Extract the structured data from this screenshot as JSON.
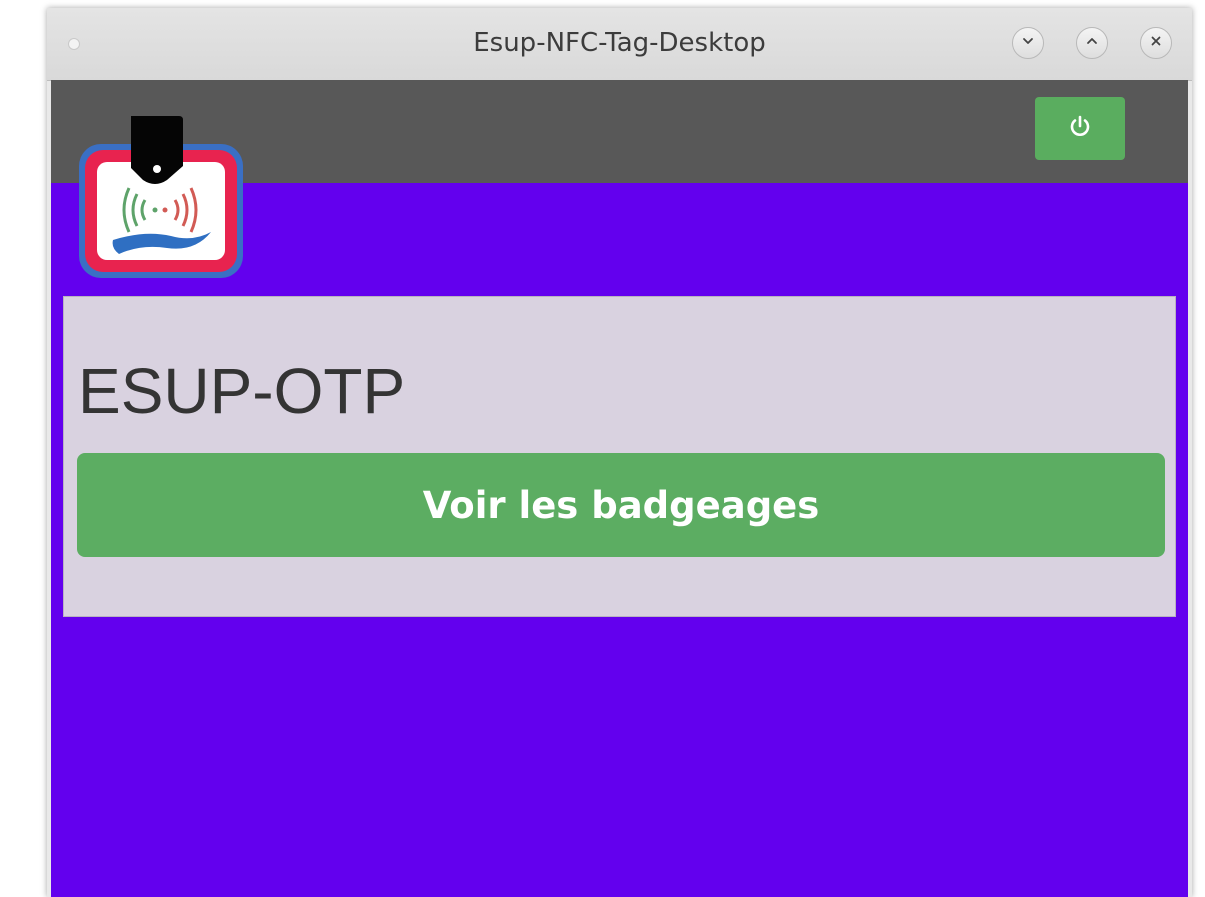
{
  "window": {
    "title": "Esup-NFC-Tag-Desktop",
    "controls": {
      "minimize_icon": "chevron-down-icon",
      "maximize_icon": "chevron-up-icon",
      "close_icon": "close-icon"
    }
  },
  "header": {
    "logout_icon": "power-icon"
  },
  "card": {
    "title": "ESUP-OTP",
    "button_label": "Voir les badgeages"
  },
  "colors": {
    "app_background": "#6300ee",
    "header_background": "#585858",
    "card_background": "#d9d2e0",
    "button_green": "#5cad62"
  }
}
